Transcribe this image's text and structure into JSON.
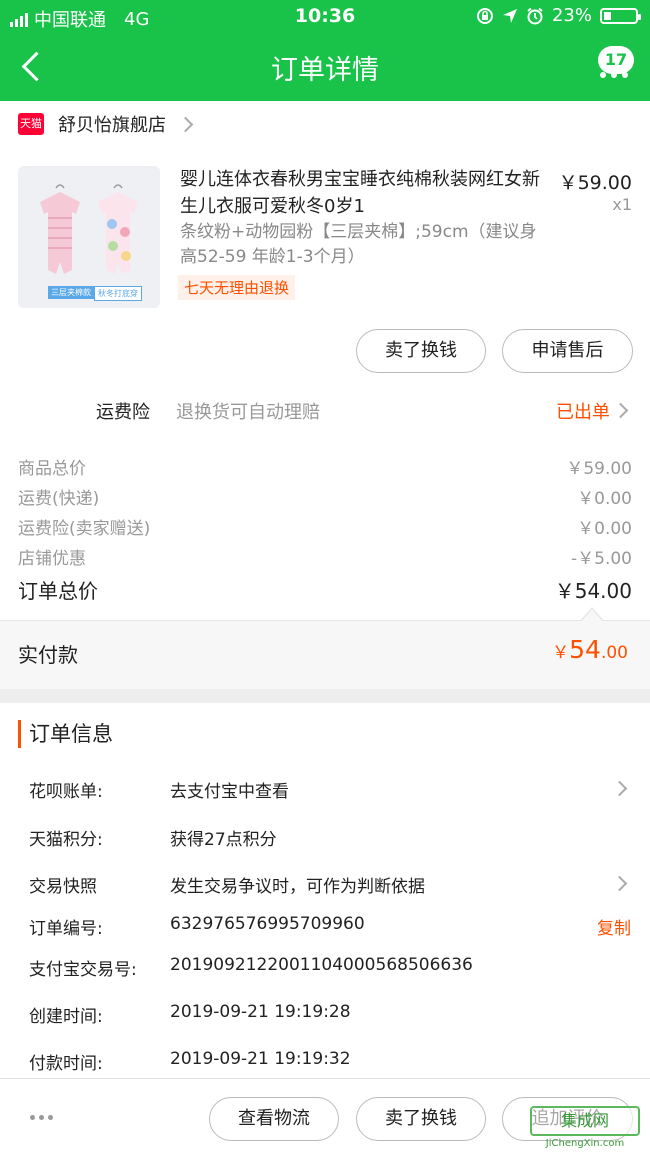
{
  "status_bar": {
    "carrier": "中国联通",
    "network": "4G",
    "time": "10:36",
    "battery": "23%",
    "battery_level": 0.23
  },
  "nav": {
    "title": "订单详情",
    "badge": "17"
  },
  "shop": {
    "logo_text": "天猫",
    "name": "舒贝怡旗舰店"
  },
  "product": {
    "title": "婴儿连体衣春秋男宝宝睡衣纯棉秋装网红女新生儿衣服可爱秋冬0岁1",
    "spec": "条纹粉+动物园粉【三层夹棉】;59cm（建议身高52-59 年龄1-3个月）",
    "tag": "七天无理由退换",
    "price": "￥59.00",
    "qty": "x1",
    "image_tags": [
      "三层夹棉款",
      "秋冬打底穿"
    ]
  },
  "product_actions": {
    "sell": "卖了换钱",
    "after_sale": "申请售后"
  },
  "insurance": {
    "label": "运费险",
    "desc": "退换货可自动理赔",
    "status": "已出单"
  },
  "costs": [
    {
      "label": "商品总价",
      "value": "￥59.00"
    },
    {
      "label": "运费(快递)",
      "value": "￥0.00"
    },
    {
      "label": "运费险(卖家赠送)",
      "value": "￥0.00"
    },
    {
      "label": "店铺优惠",
      "value": "-￥5.00"
    }
  ],
  "order_total": {
    "label": "订单总价",
    "value": "￥54.00"
  },
  "paid": {
    "label": "实付款",
    "currency": "￥",
    "integer": "54",
    "decimal": ".00"
  },
  "order_info": {
    "title": "订单信息",
    "rows": [
      {
        "label": "花呗账单:",
        "value": "去支付宝中查看"
      },
      {
        "label": "天猫积分:",
        "value": "获得27点积分"
      },
      {
        "label": "交易快照",
        "value": "发生交易争议时，可作为判断依据"
      },
      {
        "label": "订单编号:",
        "value": "632976576995709960",
        "action": "复制"
      },
      {
        "label": "支付宝交易号:",
        "value": "2019092122001104000568506636"
      },
      {
        "label": "创建时间:",
        "value": "2019-09-21 19:19:28"
      },
      {
        "label": "付款时间:",
        "value": "2019-09-21 19:19:32"
      }
    ]
  },
  "bottom_bar": {
    "logistics": "查看物流",
    "sell": "卖了换钱",
    "review": "追加评价"
  },
  "watermark": {
    "text": "集成网",
    "url": "JiChengXin.com"
  },
  "colors": {
    "brand_green": "#19c34a",
    "accent_orange": "#ff5000",
    "tmall_red": "#ff0036"
  }
}
